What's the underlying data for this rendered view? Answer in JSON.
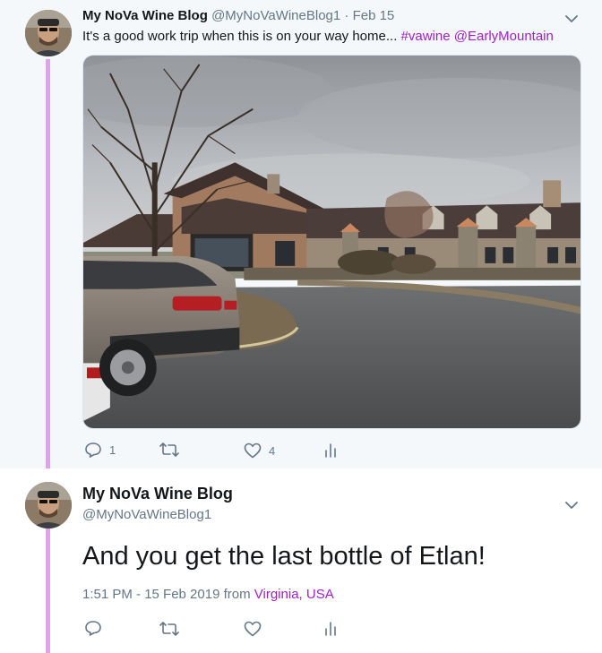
{
  "tweet1": {
    "author_name": "My NoVa Wine Blog",
    "handle": "@MyNoVaWineBlog1",
    "separator": "·",
    "date": "Feb 15",
    "text": "It's a good work trip when this is on your way home... ",
    "hashtag": "#vawine",
    "mention": "@EarlyMountain",
    "actions": {
      "reply_count": "1",
      "retweet_count": "",
      "like_count": "4"
    }
  },
  "tweet2": {
    "author_name": "My NoVa Wine Blog",
    "handle": "@MyNoVaWineBlog1",
    "text": "And you get the last bottle of Etlan!",
    "timestamp": "1:51 PM - 15 Feb 2019",
    "from_label": " from ",
    "location": "Virginia, USA"
  },
  "colors": {
    "link": "#a020c8",
    "thread_line": "#e0a2ef",
    "muted": "#657786",
    "tweet1_bg": "#f5f8fa"
  },
  "icons": [
    "chevron-down-icon",
    "reply-icon",
    "retweet-icon",
    "like-icon",
    "analytics-icon"
  ]
}
